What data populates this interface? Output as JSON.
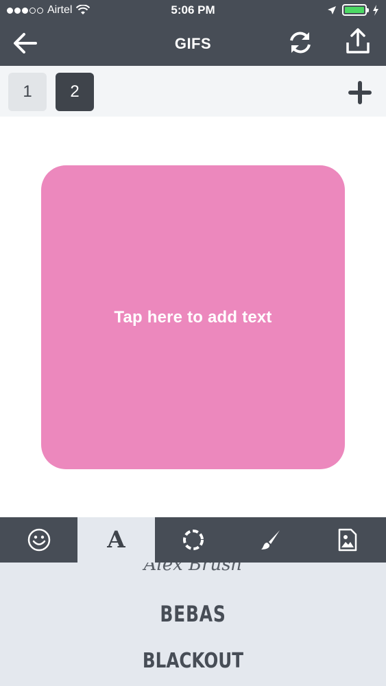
{
  "status_bar": {
    "carrier": "Airtel",
    "time": "5:06 PM",
    "signal_dots": [
      "filled",
      "filled",
      "filled",
      "empty",
      "empty"
    ],
    "icons": [
      "wifi-icon",
      "location-arrow-icon",
      "battery-icon",
      "charging-bolt-icon"
    ],
    "battery_color": "#4cd964"
  },
  "nav": {
    "title": "GIFS",
    "icons": {
      "back": "back-arrow-icon",
      "refresh": "refresh-icon",
      "share": "share-icon"
    }
  },
  "pages": {
    "items": [
      "1",
      "2"
    ],
    "selected": "2",
    "add_icon": "plus-icon"
  },
  "canvas": {
    "placeholder": "Tap here to add text",
    "background": "#ec88bd"
  },
  "toolbar": {
    "tools": [
      {
        "icon": "smiley-icon"
      },
      {
        "icon": "font-a-icon",
        "label": "A",
        "selected": true
      },
      {
        "icon": "circle-dashed-icon"
      },
      {
        "icon": "brush-icon"
      },
      {
        "icon": "image-file-icon"
      }
    ]
  },
  "fonts": {
    "items": [
      "Alex Brush",
      "BEBAS",
      "BLACKOUT"
    ]
  },
  "colors": {
    "bar": "#474d56",
    "light_bg": "#e4e8ee"
  }
}
